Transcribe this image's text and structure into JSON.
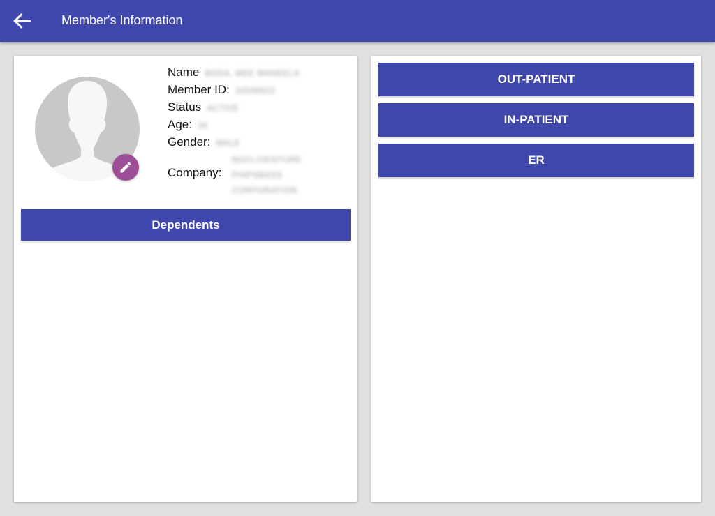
{
  "header": {
    "title": "Member's Information",
    "back_icon": "arrow-left-icon"
  },
  "colors": {
    "primary": "#3f47ad",
    "accent": "#9c4f96",
    "background": "#e0e0e0",
    "avatar": "#c8c8c8"
  },
  "member": {
    "name_label": "Name",
    "name_value": "BODA, MEE MANEELA",
    "id_label": "Member ID:",
    "id_value": "32506622",
    "status_label": "Status",
    "status_value": "ACTIVE",
    "age_label": "Age:",
    "age_value": "26",
    "gender_label": "Gender:",
    "gender_value": "MALE",
    "company_label": "Company:",
    "company_lines": [
      "NGCLIVENTURE",
      "PHIPSBASS",
      "CORPORATION"
    ],
    "avatar_icon": "person-silhouette-icon",
    "edit_icon": "pencil-icon"
  },
  "left_panel": {
    "dependents_label": "Dependents"
  },
  "right_panel": {
    "buttons": [
      {
        "label": "OUT-PATIENT"
      },
      {
        "label": "IN-PATIENT"
      },
      {
        "label": "ER"
      }
    ]
  }
}
